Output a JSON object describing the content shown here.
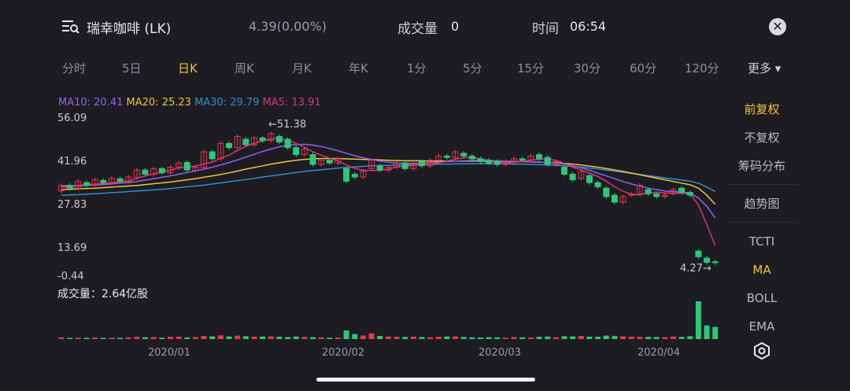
{
  "header": {
    "title": "瑞幸咖啡 (LK)",
    "price": "4.39(0.00%)",
    "volume_label": "成交量",
    "volume_value": "0",
    "time_label": "时间",
    "time_value": "06:54",
    "menu_icon": "menu-search-icon",
    "close_icon": "close-icon"
  },
  "tabs": [
    "分时",
    "5日",
    "日K",
    "周K",
    "月K",
    "年K",
    "1分",
    "5分",
    "15分",
    "30分",
    "60分",
    "120分",
    "更多"
  ],
  "active_tab": "日K",
  "ma_legend": {
    "ma10": "MA10: 20.41",
    "ma20": "MA20: 25.23",
    "ma30": "MA30: 29.79",
    "ma5": "MA5: 13.91"
  },
  "y_labels": [
    "56.09",
    "41.96",
    "27.83",
    "13.69",
    "-0.44"
  ],
  "high_marker": "←51.38",
  "low_marker": "4.27→",
  "volume_title": "成交量：2.64亿股",
  "x_labels": [
    "2020/01",
    "2020/02",
    "2020/03",
    "2020/04"
  ],
  "side_menu": {
    "fq": "前复权",
    "nfq": "不复权",
    "chip": "筹码分布",
    "trend": "趋势图",
    "tcti": "TCTI",
    "ma": "MA",
    "boll": "BOLL",
    "ema": "EMA",
    "settings_icon": "settings-hex-icon"
  },
  "colors": {
    "up": "#e8364f",
    "down": "#2ec77a",
    "ma10": "#8d63f2",
    "ma20": "#f0c33c",
    "ma30": "#2e8fd1",
    "ma5": "#d6377c",
    "accent": "#f0c33c"
  },
  "chart_data": {
    "type": "candlestick",
    "price_axis": [
      -0.44,
      56.09
    ],
    "candles": [
      {
        "o": 30.0,
        "c": 32.0
      },
      {
        "o": 32.0,
        "c": 31.0
      },
      {
        "o": 31.0,
        "c": 33.5
      },
      {
        "o": 33.0,
        "c": 32.0
      },
      {
        "o": 32.2,
        "c": 34.0
      },
      {
        "o": 33.8,
        "c": 33.0
      },
      {
        "o": 33.0,
        "c": 34.5
      },
      {
        "o": 34.4,
        "c": 33.5
      },
      {
        "o": 33.4,
        "c": 35.0
      },
      {
        "o": 34.8,
        "c": 37.5
      },
      {
        "o": 37.5,
        "c": 36.0
      },
      {
        "o": 36.0,
        "c": 38.0
      },
      {
        "o": 38.0,
        "c": 36.5
      },
      {
        "o": 36.5,
        "c": 38.5
      },
      {
        "o": 38.5,
        "c": 40.0
      },
      {
        "o": 40.2,
        "c": 37.5
      },
      {
        "o": 37.4,
        "c": 38.5
      },
      {
        "o": 38.4,
        "c": 44.0
      },
      {
        "o": 44.0,
        "c": 41.5
      },
      {
        "o": 41.5,
        "c": 47.0
      },
      {
        "o": 47.0,
        "c": 45.5
      },
      {
        "o": 45.5,
        "c": 49.5
      },
      {
        "o": 48.5,
        "c": 46.5
      },
      {
        "o": 46.5,
        "c": 49.0
      },
      {
        "o": 49.0,
        "c": 48.0
      },
      {
        "o": 48.0,
        "c": 50.5
      },
      {
        "o": 49.5,
        "c": 47.5
      },
      {
        "o": 48.5,
        "c": 45.5
      },
      {
        "o": 45.5,
        "c": 43.0
      },
      {
        "o": 43.0,
        "c": 45.0
      },
      {
        "o": 43.0,
        "c": 39.5
      },
      {
        "o": 39.5,
        "c": 41.0
      },
      {
        "o": 41.0,
        "c": 40.0
      },
      {
        "o": 40.0,
        "c": 41.5
      },
      {
        "o": 38.0,
        "c": 33.5
      },
      {
        "o": 36.0,
        "c": 35.0
      },
      {
        "o": 35.0,
        "c": 37.0
      },
      {
        "o": 38.0,
        "c": 41.0
      },
      {
        "o": 39.0,
        "c": 37.5
      },
      {
        "o": 37.5,
        "c": 38.5
      },
      {
        "o": 38.5,
        "c": 40.0
      },
      {
        "o": 40.0,
        "c": 38.0
      },
      {
        "o": 38.0,
        "c": 39.5
      },
      {
        "o": 40.5,
        "c": 39.0
      },
      {
        "o": 39.0,
        "c": 41.0
      },
      {
        "o": 41.0,
        "c": 42.5
      },
      {
        "o": 42.5,
        "c": 42.0
      },
      {
        "o": 42.0,
        "c": 44.0
      },
      {
        "o": 43.5,
        "c": 42.5
      },
      {
        "o": 42.5,
        "c": 41.5
      },
      {
        "o": 41.5,
        "c": 40.5
      },
      {
        "o": 41.0,
        "c": 40.0
      },
      {
        "o": 40.5,
        "c": 39.5
      },
      {
        "o": 39.5,
        "c": 40.5
      },
      {
        "o": 40.5,
        "c": 41.5
      },
      {
        "o": 41.5,
        "c": 41.0
      },
      {
        "o": 41.0,
        "c": 42.5
      },
      {
        "o": 43.0,
        "c": 41.5
      },
      {
        "o": 42.0,
        "c": 39.5
      },
      {
        "o": 39.5,
        "c": 40.5
      },
      {
        "o": 38.5,
        "c": 36.0
      },
      {
        "o": 36.0,
        "c": 34.0
      },
      {
        "o": 34.5,
        "c": 37.0
      },
      {
        "o": 35.5,
        "c": 33.0
      },
      {
        "o": 33.0,
        "c": 31.5
      },
      {
        "o": 31.0,
        "c": 28.0
      },
      {
        "o": 28.5,
        "c": 26.0
      },
      {
        "o": 26.0,
        "c": 28.0
      },
      {
        "o": 28.5,
        "c": 29.0
      },
      {
        "o": 29.0,
        "c": 32.0
      },
      {
        "o": 30.5,
        "c": 29.0
      },
      {
        "o": 29.0,
        "c": 28.0
      },
      {
        "o": 28.0,
        "c": 28.5
      },
      {
        "o": 29.0,
        "c": 30.5
      },
      {
        "o": 31.0,
        "c": 29.5
      },
      {
        "o": 29.5,
        "c": 28.5
      },
      {
        "o": 8.5,
        "c": 6.5
      },
      {
        "o": 6.0,
        "c": 4.5
      },
      {
        "o": 4.7,
        "c": 4.4
      }
    ],
    "volume": [
      1.2,
      0.8,
      1.0,
      0.9,
      1.1,
      0.8,
      1.0,
      0.9,
      1.2,
      1.5,
      1.3,
      1.4,
      1.0,
      1.6,
      1.7,
      1.2,
      1.4,
      2.2,
      1.9,
      2.6,
      1.8,
      2.4,
      2.0,
      1.7,
      1.8,
      1.9,
      1.6,
      1.4,
      1.8,
      1.5,
      1.3,
      1.2,
      1.0,
      1.1,
      6.0,
      3.5,
      2.5,
      4.0,
      2.2,
      1.8,
      1.6,
      1.5,
      1.7,
      1.4,
      1.3,
      1.6,
      1.8,
      1.9,
      1.5,
      1.2,
      1.1,
      1.3,
      1.2,
      1.0,
      1.4,
      1.2,
      1.1,
      1.6,
      1.8,
      1.3,
      2.0,
      1.9,
      2.2,
      1.7,
      1.6,
      2.4,
      2.1,
      1.9,
      1.7,
      1.6,
      1.5,
      1.4,
      1.3,
      1.8,
      1.5,
      2.0,
      26.4,
      9.5,
      8.5
    ],
    "ma5": [
      32.0,
      32.0,
      32.0,
      32.3,
      32.4,
      32.7,
      32.9,
      33.3,
      33.6,
      34.5,
      35.4,
      36.1,
      36.8,
      37.5,
      38.2,
      38.6,
      38.9,
      39.7,
      40.3,
      41.7,
      42.8,
      44.5,
      45.9,
      47.1,
      47.9,
      48.6,
      48.8,
      48.2,
      47.0,
      45.6,
      44.0,
      42.8,
      41.7,
      40.8,
      39.3,
      38.1,
      37.4,
      37.3,
      37.4,
      37.8,
      38.6,
      38.9,
      39.2,
      39.3,
      39.5,
      40.0,
      40.7,
      41.4,
      41.9,
      42.0,
      41.5,
      41.0,
      40.5,
      40.1,
      40.2,
      40.5,
      41.0,
      41.4,
      41.3,
      41.0,
      39.9,
      38.5,
      37.5,
      36.4,
      35.2,
      33.5,
      31.5,
      29.9,
      28.8,
      28.6,
      29.3,
      29.6,
      29.3,
      29.2,
      29.2,
      29.0,
      25.0,
      18.0,
      10.5
    ],
    "ma10": [
      31.5,
      31.6,
      31.8,
      32.0,
      32.1,
      32.3,
      32.5,
      32.8,
      33.0,
      33.4,
      33.9,
      34.4,
      34.9,
      35.4,
      36.0,
      36.6,
      37.2,
      37.8,
      38.5,
      39.3,
      40.2,
      41.1,
      42.1,
      43.1,
      44.1,
      45.0,
      45.8,
      46.3,
      46.6,
      46.7,
      46.4,
      45.9,
      45.2,
      44.4,
      43.5,
      42.6,
      41.9,
      41.2,
      40.7,
      40.3,
      40.0,
      39.9,
      39.9,
      40.0,
      40.1,
      40.3,
      40.5,
      40.7,
      40.8,
      40.9,
      40.9,
      40.9,
      40.8,
      40.7,
      40.6,
      40.5,
      40.4,
      40.3,
      40.2,
      40.0,
      39.6,
      39.0,
      38.3,
      37.4,
      36.4,
      35.4,
      34.4,
      33.4,
      32.5,
      31.8,
      31.0,
      30.5,
      30.0,
      29.8,
      29.6,
      29.3,
      27.5,
      24.5,
      20.4
    ],
    "ma20": [
      30.5,
      30.6,
      30.8,
      30.9,
      31.0,
      31.2,
      31.4,
      31.6,
      31.8,
      32.0,
      32.3,
      32.6,
      32.9,
      33.2,
      33.6,
      34.0,
      34.4,
      34.9,
      35.4,
      35.9,
      36.5,
      37.1,
      37.8,
      38.4,
      39.0,
      39.6,
      40.1,
      40.6,
      41.0,
      41.3,
      41.5,
      41.6,
      41.6,
      41.6,
      41.5,
      41.4,
      41.3,
      41.2,
      41.1,
      41.0,
      40.9,
      40.8,
      40.8,
      40.8,
      40.7,
      40.7,
      40.7,
      40.7,
      40.7,
      40.7,
      40.7,
      40.6,
      40.6,
      40.5,
      40.5,
      40.5,
      40.4,
      40.3,
      40.2,
      40.1,
      39.9,
      39.6,
      39.3,
      38.9,
      38.5,
      38.0,
      37.5,
      37.0,
      36.4,
      35.8,
      35.2,
      34.6,
      34.0,
      33.4,
      32.8,
      32.2,
      31.0,
      28.5,
      25.2
    ],
    "ma30": [
      28.5,
      28.6,
      28.7,
      28.9,
      29.0,
      29.2,
      29.4,
      29.6,
      29.8,
      30.0,
      30.2,
      30.4,
      30.6,
      30.9,
      31.2,
      31.5,
      31.8,
      32.1,
      32.5,
      32.9,
      33.3,
      33.7,
      34.1,
      34.5,
      35.0,
      35.4,
      35.8,
      36.2,
      36.6,
      37.0,
      37.3,
      37.6,
      37.9,
      38.2,
      38.4,
      38.6,
      38.8,
      39.0,
      39.1,
      39.2,
      39.3,
      39.4,
      39.4,
      39.5,
      39.5,
      39.6,
      39.6,
      39.7,
      39.7,
      39.7,
      39.7,
      39.7,
      39.7,
      39.7,
      39.6,
      39.6,
      39.5,
      39.4,
      39.3,
      39.2,
      39.0,
      38.8,
      38.5,
      38.2,
      37.9,
      37.5,
      37.1,
      36.7,
      36.3,
      35.9,
      35.5,
      35.1,
      34.7,
      34.3,
      33.9,
      33.5,
      32.8,
      31.4,
      29.8
    ]
  }
}
